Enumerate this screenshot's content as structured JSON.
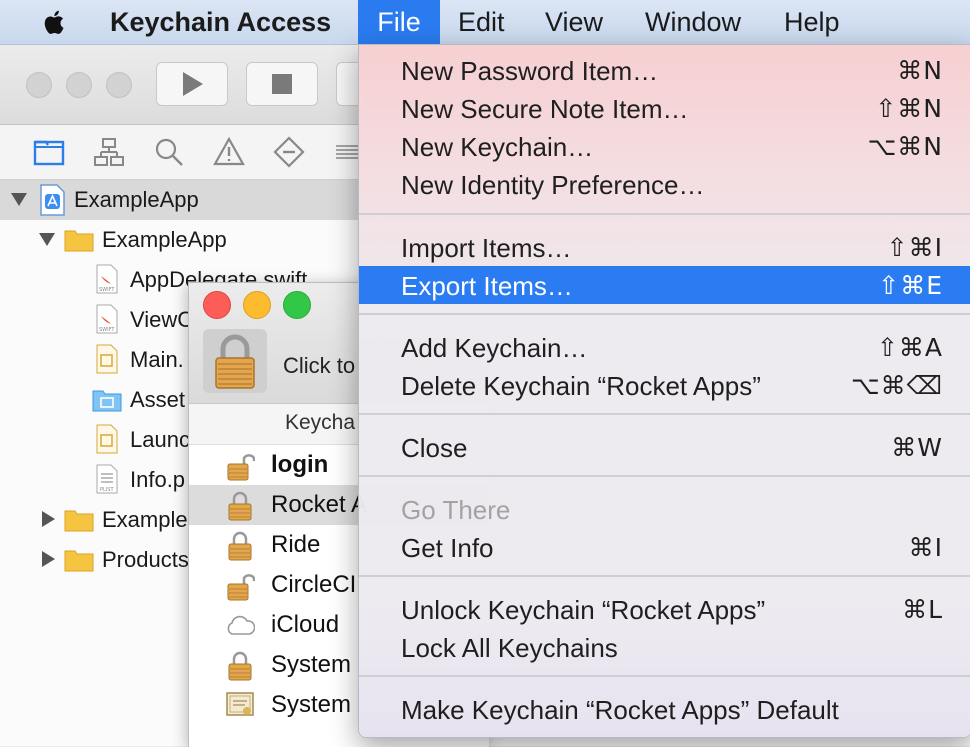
{
  "menubar": {
    "app_name": "Keychain Access",
    "menus": [
      "File",
      "Edit",
      "View",
      "Window",
      "Help"
    ]
  },
  "xcode": {
    "tree": [
      {
        "label": "ExampleApp",
        "level": 0,
        "expanded": true,
        "selected": true,
        "icon": "project-icon"
      },
      {
        "label": "ExampleApp",
        "level": 1,
        "expanded": true,
        "icon": "folder-icon"
      },
      {
        "label": "AppDelegate.swift",
        "level": 2,
        "icon": "swift-file-icon"
      },
      {
        "label": "ViewC",
        "level": 2,
        "icon": "swift-file-icon"
      },
      {
        "label": "Main.",
        "level": 2,
        "icon": "storyboard-file-icon"
      },
      {
        "label": "Asset",
        "level": 2,
        "icon": "asset-catalog-icon"
      },
      {
        "label": "Launc",
        "level": 2,
        "icon": "storyboard-file-icon"
      },
      {
        "label": "Info.p",
        "level": 2,
        "icon": "plist-file-icon"
      },
      {
        "label": "Example",
        "level": 1,
        "expanded": false,
        "icon": "folder-icon"
      },
      {
        "label": "Products",
        "level": 1,
        "expanded": false,
        "icon": "folder-icon"
      }
    ]
  },
  "keychain": {
    "click_text": "Click to",
    "column_header": "Keycha",
    "items": [
      {
        "name": "login",
        "bold": true,
        "icon": "unlocked-lock-icon"
      },
      {
        "name": "Rocket A",
        "selected": true,
        "icon": "lock-icon"
      },
      {
        "name": "Ride",
        "icon": "lock-icon"
      },
      {
        "name": "CircleCI",
        "icon": "unlocked-lock-icon"
      },
      {
        "name": "iCloud",
        "icon": "cloud-icon"
      },
      {
        "name": "System",
        "icon": "lock-icon"
      },
      {
        "name": "System",
        "icon": "certificate-icon"
      }
    ]
  },
  "file_menu": {
    "groups": [
      [
        {
          "label": "New Password Item…",
          "shortcut": "⌘N"
        },
        {
          "label": "New Secure Note Item…",
          "shortcut": "⇧⌘N"
        },
        {
          "label": "New Keychain…",
          "shortcut": "⌥⌘N"
        },
        {
          "label": "New Identity Preference…",
          "shortcut": ""
        }
      ],
      [
        {
          "label": "Import Items…",
          "shortcut": "⇧⌘I"
        },
        {
          "label": "Export Items…",
          "shortcut": "⇧⌘E",
          "highlighted": true
        }
      ],
      [
        {
          "label": "Add Keychain…",
          "shortcut": "⇧⌘A"
        },
        {
          "label": "Delete Keychain “Rocket Apps”",
          "shortcut": "⌥⌘⌫"
        }
      ],
      [
        {
          "label": "Close",
          "shortcut": "⌘W"
        }
      ],
      [
        {
          "label": "Go There",
          "shortcut": "",
          "disabled": true
        },
        {
          "label": "Get Info",
          "shortcut": "⌘I"
        }
      ],
      [
        {
          "label": "Unlock Keychain “Rocket Apps”",
          "shortcut": "⌘L"
        },
        {
          "label": "Lock All Keychains",
          "shortcut": ""
        }
      ],
      [
        {
          "label": "Make Keychain “Rocket Apps” Default",
          "shortcut": ""
        }
      ]
    ]
  },
  "colors": {
    "menu_highlight": "#2b7cf2",
    "active_menu": "#2a7bf0",
    "folder": "#f5c542"
  }
}
